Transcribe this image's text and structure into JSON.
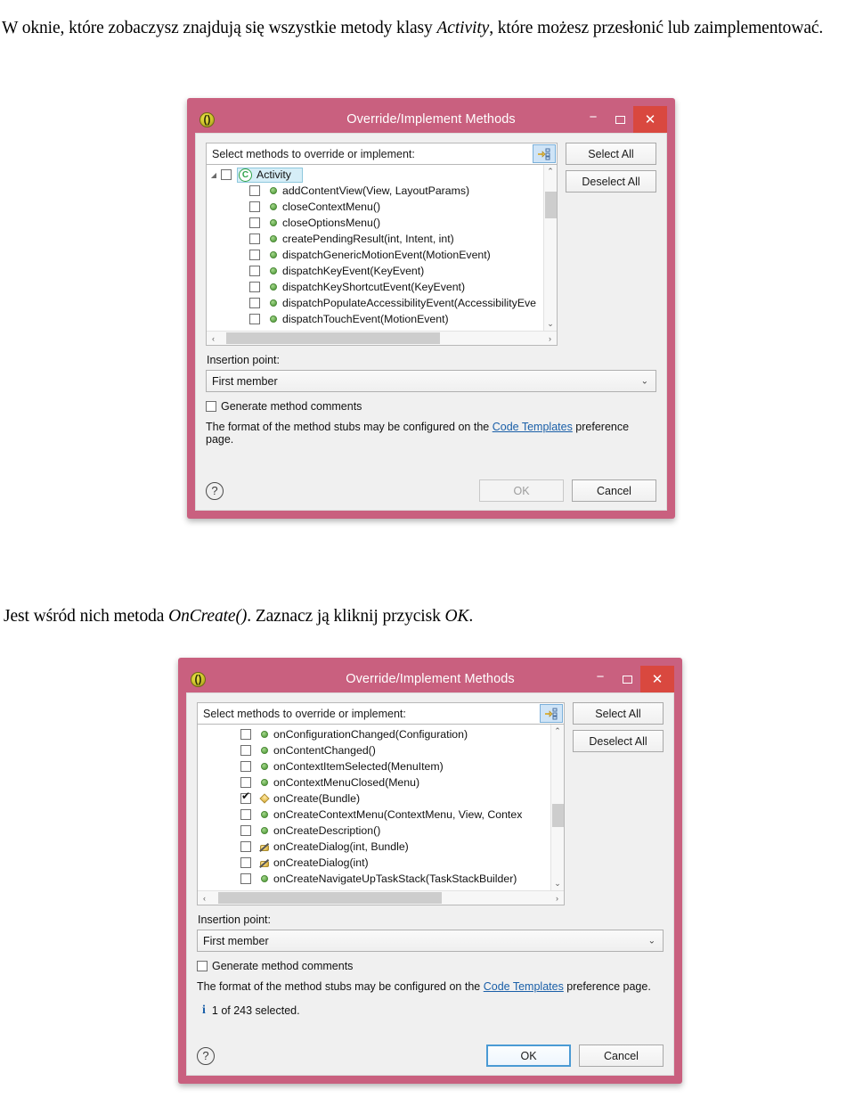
{
  "document": {
    "intro_paragraph_parts": {
      "before": "W oknie, które zobaczysz znajdują się wszystkie metody klasy ",
      "emphasis": "Activity",
      "after": ", które możesz przesłonić lub zaimplementować."
    },
    "middle_paragraph_parts": {
      "before": "Jest wśród nich metoda ",
      "emphasis1": "OnCreate()",
      "middle": ". Zaznacz ją kliknij przycisk ",
      "emphasis2": "OK",
      "after": "."
    }
  },
  "colors": {
    "titlebar_pink": "#c9607f",
    "close_red": "#d9483f",
    "dialog_body": "#f0f0f0",
    "link_blue": "#1a5fa8",
    "selection_blue": "#d6eef7",
    "filter_button_blue": "#cfe4f7",
    "icon_green": "#63a84c",
    "icon_yellow": "#e9c253"
  },
  "dialog1": {
    "title": "Override/Implement Methods",
    "app_icon": "eclipse-icon",
    "window_buttons": {
      "minimize": "−",
      "maximize": "maximize-icon",
      "close": "✕"
    },
    "list_header_label": "Select methods to override or implement:",
    "filter_button_icon": "filter-tree-icon",
    "select_all_label": "Select All",
    "deselect_all_label": "Deselect All",
    "tree": [
      {
        "label": "Activity",
        "icon": "class-icon",
        "checked": false,
        "selected": true,
        "level": 0,
        "twisty": "▲"
      },
      {
        "label": "addContentView(View, LayoutParams)",
        "icon": "public-method-icon",
        "checked": false,
        "selected": false,
        "level": 1
      },
      {
        "label": "closeContextMenu()",
        "icon": "public-method-icon",
        "checked": false,
        "selected": false,
        "level": 1
      },
      {
        "label": "closeOptionsMenu()",
        "icon": "public-method-icon",
        "checked": false,
        "selected": false,
        "level": 1
      },
      {
        "label": "createPendingResult(int, Intent, int)",
        "icon": "public-method-icon",
        "checked": false,
        "selected": false,
        "level": 1
      },
      {
        "label": "dispatchGenericMotionEvent(MotionEvent)",
        "icon": "public-method-icon",
        "checked": false,
        "selected": false,
        "level": 1
      },
      {
        "label": "dispatchKeyEvent(KeyEvent)",
        "icon": "public-method-icon",
        "checked": false,
        "selected": false,
        "level": 1
      },
      {
        "label": "dispatchKeyShortcutEvent(KeyEvent)",
        "icon": "public-method-icon",
        "checked": false,
        "selected": false,
        "level": 1
      },
      {
        "label": "dispatchPopulateAccessibilityEvent(AccessibilityEve",
        "icon": "public-method-icon",
        "checked": false,
        "selected": false,
        "level": 1
      },
      {
        "label": "dispatchTouchEvent(MotionEvent)",
        "icon": "public-method-icon",
        "checked": false,
        "selected": false,
        "level": 1
      }
    ],
    "insertion_point_label": "Insertion point:",
    "insertion_point_value": "First member",
    "generate_comments_label": "Generate method comments",
    "generate_comments_checked": false,
    "hint_before": "The format of the method stubs may be configured on the ",
    "hint_link": "Code Templates",
    "hint_after": " preference page.",
    "status_text": "",
    "help_icon": "?",
    "ok_label": "OK",
    "ok_enabled": false,
    "cancel_label": "Cancel",
    "scroll": {
      "v_thumb_top_pct": 8,
      "v_thumb_height_pct": 16,
      "h_thumb_left_pct": 2,
      "h_thumb_width_pct": 66
    }
  },
  "dialog2": {
    "title": "Override/Implement Methods",
    "app_icon": "eclipse-icon",
    "window_buttons": {
      "minimize": "−",
      "maximize": "maximize-icon",
      "close": "✕"
    },
    "list_header_label": "Select methods to override or implement:",
    "filter_button_icon": "filter-tree-icon",
    "select_all_label": "Select All",
    "deselect_all_label": "Deselect All",
    "tree": [
      {
        "label": "onConfigurationChanged(Configuration)",
        "icon": "public-method-icon",
        "checked": false,
        "selected": false,
        "level": 1
      },
      {
        "label": "onContentChanged()",
        "icon": "public-method-icon",
        "checked": false,
        "selected": false,
        "level": 1
      },
      {
        "label": "onContextItemSelected(MenuItem)",
        "icon": "public-method-icon",
        "checked": false,
        "selected": false,
        "level": 1
      },
      {
        "label": "onContextMenuClosed(Menu)",
        "icon": "public-method-icon",
        "checked": false,
        "selected": false,
        "level": 1
      },
      {
        "label": "onCreate(Bundle)",
        "icon": "protected-method-icon",
        "checked": true,
        "selected": false,
        "level": 1
      },
      {
        "label": "onCreateContextMenu(ContextMenu, View, Contex",
        "icon": "public-method-icon",
        "checked": false,
        "selected": false,
        "level": 1
      },
      {
        "label": "onCreateDescription()",
        "icon": "public-method-icon",
        "checked": false,
        "selected": false,
        "level": 1
      },
      {
        "label": "onCreateDialog(int, Bundle)",
        "icon": "deprecated-method-icon",
        "checked": false,
        "selected": false,
        "level": 1
      },
      {
        "label": "onCreateDialog(int)",
        "icon": "deprecated-method-icon",
        "checked": false,
        "selected": false,
        "level": 1
      },
      {
        "label": "onCreateNavigateUpTaskStack(TaskStackBuilder)",
        "icon": "public-method-icon",
        "checked": false,
        "selected": false,
        "level": 1
      }
    ],
    "insertion_point_label": "Insertion point:",
    "insertion_point_value": "First member",
    "generate_comments_label": "Generate method comments",
    "generate_comments_checked": false,
    "hint_before": "The format of the method stubs may be configured on the ",
    "hint_link": "Code Templates",
    "hint_after": " preference page.",
    "status_text": "1 of 243 selected.",
    "status_icon": "info-icon",
    "help_icon": "?",
    "ok_label": "OK",
    "ok_enabled": true,
    "cancel_label": "Cancel",
    "scroll": {
      "v_thumb_top_pct": 40,
      "v_thumb_height_pct": 14,
      "h_thumb_left_pct": 2,
      "h_thumb_width_pct": 66
    }
  }
}
